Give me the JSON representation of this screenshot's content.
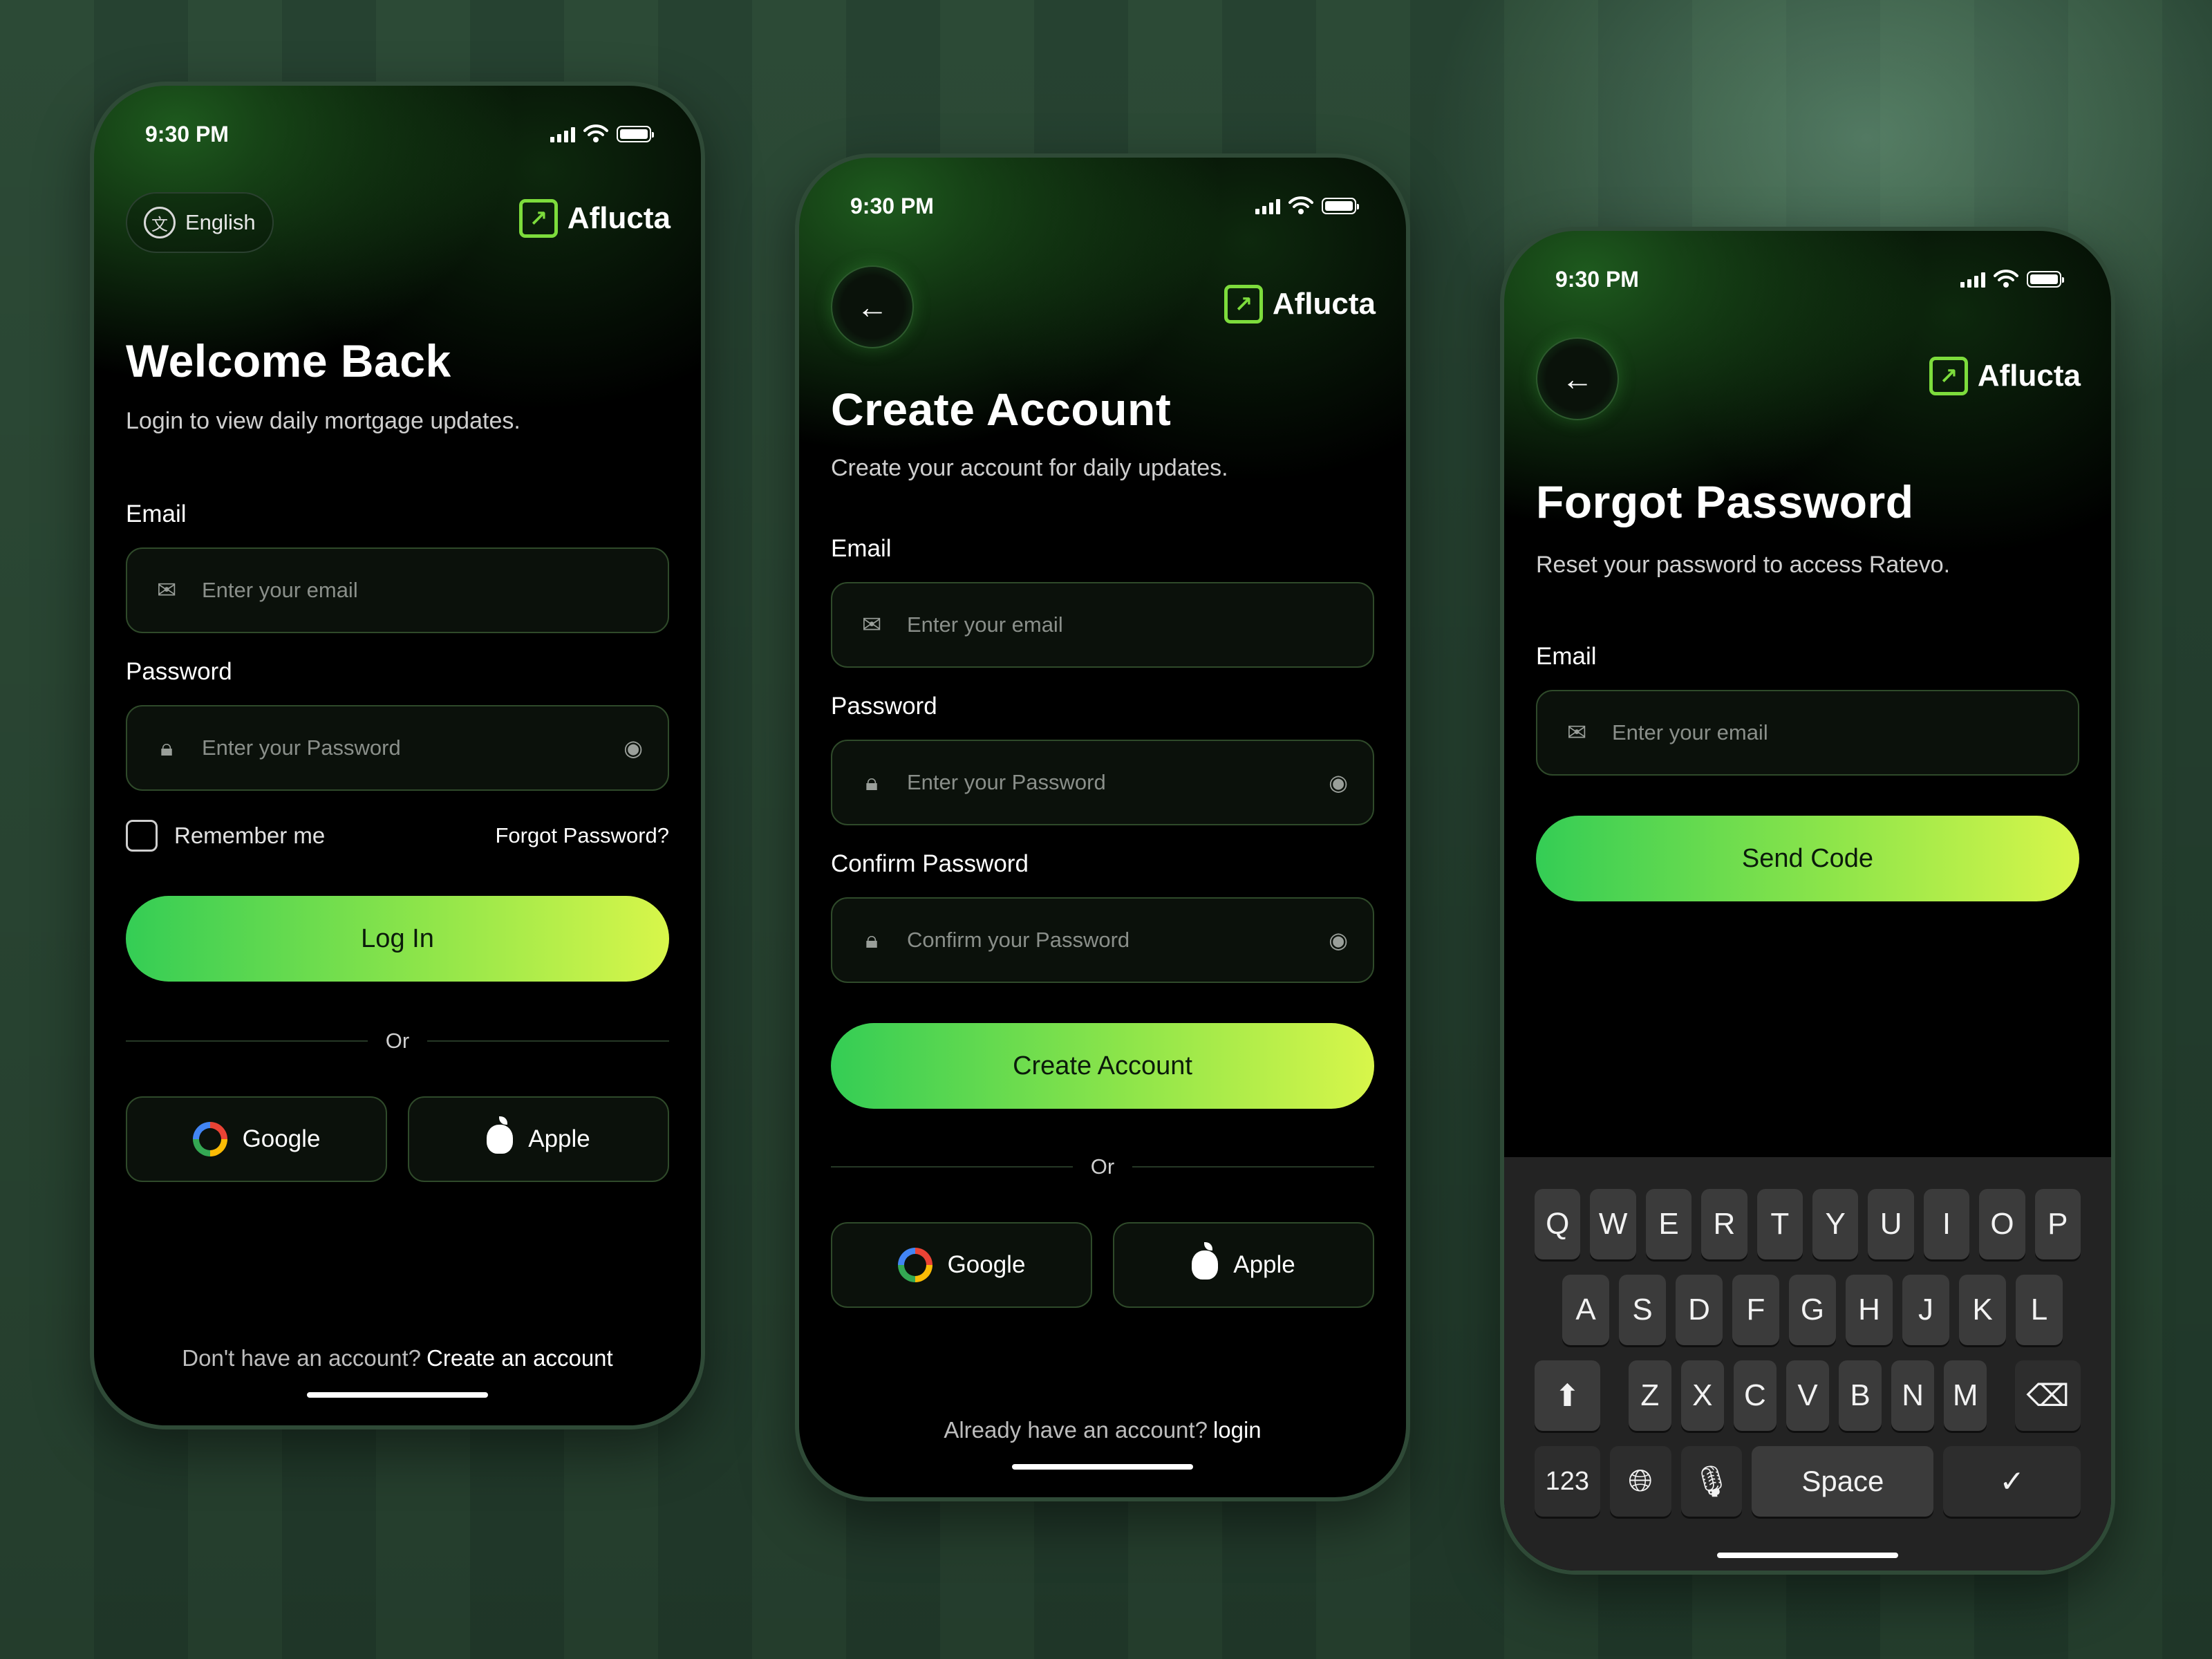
{
  "status": {
    "time": "9:30 PM"
  },
  "brand": {
    "name": "Aflucta"
  },
  "login": {
    "language": "English",
    "title": "Welcome Back",
    "subtitle": "Login to view daily mortgage updates.",
    "email_label": "Email",
    "email_placeholder": "Enter your email",
    "password_label": "Password",
    "password_placeholder": "Enter your Password",
    "remember": "Remember me",
    "forgot": "Forgot Password?",
    "cta": "Log In",
    "or": "Or",
    "google": "Google",
    "apple": "Apple",
    "footer_text": "Don't have an account?",
    "footer_link": "Create an account"
  },
  "create": {
    "title": "Create Account",
    "subtitle": "Create your account for daily updates.",
    "email_label": "Email",
    "email_placeholder": "Enter your email",
    "password_label": "Password",
    "password_placeholder": "Enter your Password",
    "confirm_label": "Confirm Password",
    "confirm_placeholder": "Confirm your Password",
    "cta": "Create Account",
    "or": "Or",
    "google": "Google",
    "apple": "Apple",
    "footer_text": "Already have an account?",
    "footer_link": "login"
  },
  "forgot": {
    "title": "Forgot Password",
    "subtitle": "Reset your password to access Ratevo.",
    "email_label": "Email",
    "email_placeholder": "Enter your email",
    "cta": "Send Code"
  },
  "keyboard": {
    "row1": [
      "Q",
      "W",
      "E",
      "R",
      "T",
      "Y",
      "U",
      "I",
      "O",
      "P"
    ],
    "row2": [
      "A",
      "S",
      "D",
      "F",
      "G",
      "H",
      "J",
      "K",
      "L"
    ],
    "row3": [
      "Z",
      "X",
      "C",
      "V",
      "B",
      "N",
      "M"
    ],
    "num": "123",
    "space": "Space",
    "done": "✓"
  },
  "colors": {
    "accent_start": "#34cd55",
    "accent_end": "#d8f64a",
    "logo": "#7ddc3c"
  }
}
